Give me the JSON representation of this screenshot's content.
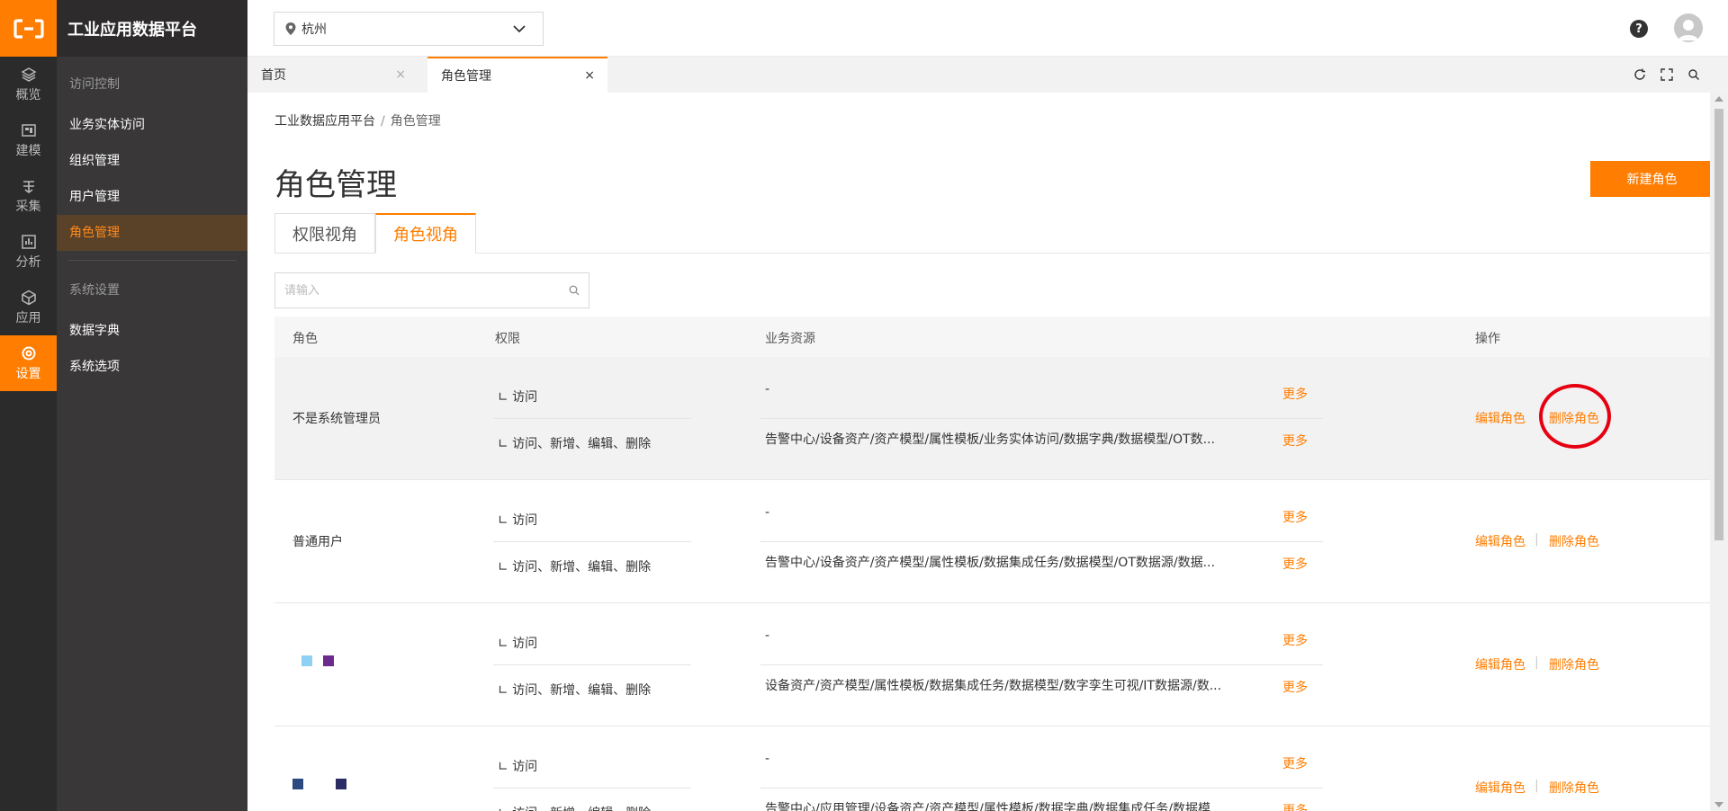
{
  "brand": {
    "title": "工业应用数据平台"
  },
  "rail": [
    {
      "label": "概览",
      "icon": "layers-icon"
    },
    {
      "label": "建模",
      "icon": "model-icon"
    },
    {
      "label": "采集",
      "icon": "collect-icon"
    },
    {
      "label": "分析",
      "icon": "chart-icon"
    },
    {
      "label": "应用",
      "icon": "cube-icon"
    },
    {
      "label": "设置",
      "icon": "settings-icon",
      "active": true
    }
  ],
  "sidebar": {
    "group1": "访问控制",
    "items1": [
      "业务实体访问",
      "组织管理",
      "用户管理",
      "角色管理"
    ],
    "group2": "系统设置",
    "items2": [
      "数据字典",
      "系统选项"
    ]
  },
  "topbar": {
    "city": "杭州",
    "help": "?"
  },
  "page_tabs": [
    {
      "label": "首页",
      "close": "×"
    },
    {
      "label": "角色管理",
      "close": "×"
    }
  ],
  "breadcrumb": {
    "root": "工业数据应用平台",
    "sep": "/",
    "current": "角色管理"
  },
  "page_title": "角色管理",
  "new_button": "新建角色",
  "view_tabs": [
    "权限视角",
    "角色视角"
  ],
  "search": {
    "placeholder": "请输入"
  },
  "table": {
    "headers": {
      "role": "角色",
      "perm": "权限",
      "resource": "业务资源",
      "ops": "操作"
    },
    "rows": [
      {
        "role": "不是系统管理员",
        "perm1": "∟ 访问",
        "perm2": "∟ 访问、新增、编辑、删除",
        "res1": "-",
        "res2": "告警中心/设备资产/资产模型/属性模板/业务实体访问/数据字典/数据模型/OT数...",
        "more": "更多",
        "edit": "编辑角色",
        "delete": "删除角色"
      },
      {
        "role": "普通用户",
        "perm1": "∟ 访问",
        "perm2": "∟ 访问、新增、编辑、删除",
        "res1": "-",
        "res2": "告警中心/设备资产/资产模型/属性模板/数据集成任务/数据模型/OT数据源/数据...",
        "more": "更多",
        "edit": "编辑角色",
        "delete": "删除角色"
      },
      {
        "role": "",
        "perm1": "∟ 访问",
        "perm2": "∟ 访问、新增、编辑、删除",
        "res1": "-",
        "res2": "设备资产/资产模型/属性模板/数据集成任务/数据模型/数字孪生可视/IT数据源/数...",
        "more": "更多",
        "edit": "编辑角色",
        "delete": "删除角色"
      },
      {
        "role": "",
        "perm1": "∟ 访问",
        "perm2": "∟ 访问、新增、编辑、删除",
        "res1": "-",
        "res2": "告警中心/应用管理/设备资产/资产模型/属性模板/数据字典/数据集成任务/数据模...",
        "more": "更多",
        "edit": "编辑角色",
        "delete": "删除角色"
      }
    ],
    "op_sep": "|"
  },
  "colors": {
    "accent": "#ff7d00",
    "highlight": "#e60012"
  }
}
